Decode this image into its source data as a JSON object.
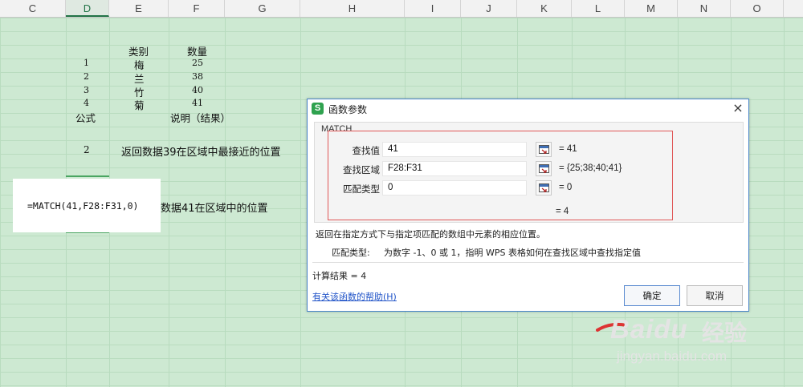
{
  "columns": [
    "C",
    "D",
    "E",
    "F",
    "G",
    "H",
    "I",
    "J",
    "K",
    "L",
    "M",
    "N",
    "O"
  ],
  "active_column": "D",
  "sheet": {
    "header_category": "类别",
    "header_quantity": "数量",
    "rows": [
      {
        "index": "1",
        "category": "梅",
        "quantity": "25"
      },
      {
        "index": "2",
        "category": "兰",
        "quantity": "38"
      },
      {
        "index": "3",
        "category": "竹",
        "quantity": "40"
      },
      {
        "index": "4",
        "category": "菊",
        "quantity": "41"
      }
    ],
    "formula_header": "公式",
    "description_header": "说明（结果）",
    "result_row1_value": "2",
    "result_row1_desc": "返回数据39在区域中最接近的位置",
    "result_row2_desc": "数据41在区域中的位置",
    "formula_text": "=MATCH(41,F28:F31,0)"
  },
  "dialog": {
    "title": "函数参数",
    "close_symbol": "×",
    "group_title": "MATCH",
    "params": [
      {
        "label": "查找值",
        "value": "41",
        "result": "=  41"
      },
      {
        "label": "查找区域",
        "value": "F28:F31",
        "result": "=  {25;38;40;41}"
      },
      {
        "label": "匹配类型",
        "value": "0",
        "result": "=  0"
      }
    ],
    "total_result": "=  4",
    "description": "返回在指定方式下与指定项匹配的数组中元素的相应位置。",
    "param_desc_label": "匹配类型:",
    "param_desc": "为数字 -1、0 或 1，指明 WPS 表格如何在查找区域中查找指定值",
    "calc_result": "计算结果  =  4",
    "help_link": "有关该函数的帮助(H)",
    "ok_label": "确定",
    "cancel_label": "取消"
  },
  "watermark": {
    "brand": "Baidu",
    "cn": "经验",
    "url": "jingyan.baidu.com"
  }
}
